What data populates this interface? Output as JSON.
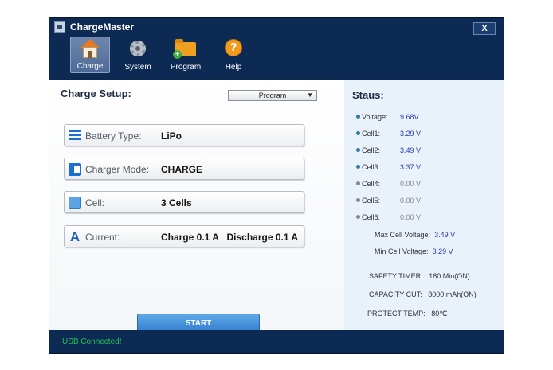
{
  "window": {
    "title": "ChargeMaster",
    "close_label": "X"
  },
  "toolbar": {
    "items": [
      {
        "label": "Charge",
        "icon": "home-icon",
        "active": true
      },
      {
        "label": "System",
        "icon": "gear-icon"
      },
      {
        "label": "Program",
        "icon": "folder-add-icon"
      },
      {
        "label": "Help",
        "icon": "help-icon"
      }
    ]
  },
  "setup": {
    "title": "Charge Setup:",
    "program_select": "Program",
    "fields": [
      {
        "label": "Battery Type:",
        "value": "LiPo",
        "icon": "list-icon"
      },
      {
        "label": "Charger Mode:",
        "value": "CHARGE",
        "icon": "charger-icon"
      },
      {
        "label": "Cell:",
        "value": "3 Cells",
        "icon": "cell-icon"
      },
      {
        "label": "Current:",
        "value": "Charge 0.1 A   Discharge 0.1 A",
        "icon": "current-icon"
      }
    ],
    "start_label": "START"
  },
  "status": {
    "title": "Staus:",
    "rows": [
      {
        "label": "Voltage:",
        "value": "9.68V"
      },
      {
        "label": "Cell1:",
        "value": "3.29 V"
      },
      {
        "label": "Cell2:",
        "value": "3.49 V"
      },
      {
        "label": "Cell3:",
        "value": "3.37 V"
      },
      {
        "label": "Cell4:",
        "value": "0.00 V"
      },
      {
        "label": "Cell5:",
        "value": "0.00 V"
      },
      {
        "label": "Cell6:",
        "value": "0.00 V"
      }
    ],
    "max_cell_label": "Max Cell Voltage:",
    "max_cell_value": "3.49 V",
    "min_cell_label": "Min Cell Voltage:",
    "min_cell_value": "3.29 V",
    "safety_label": "SAFETY TIMER:",
    "safety_value": "180 Min(ON)",
    "capacity_label": "CAPACITY CUT:",
    "capacity_value": "8000 mAh(ON)",
    "protect_label": "PROTECT TEMP:",
    "protect_value": "80℃"
  },
  "statusbar": {
    "usb": "USB Connected!"
  }
}
